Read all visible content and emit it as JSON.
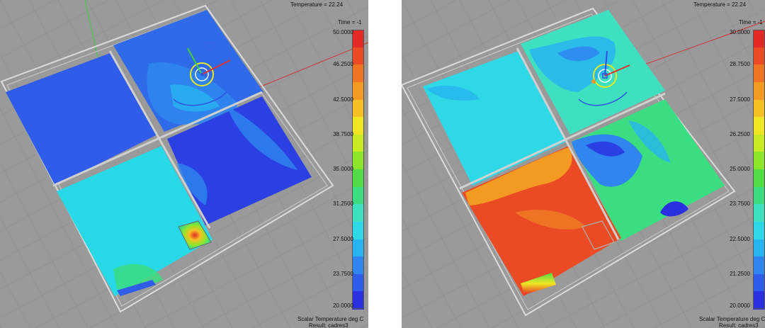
{
  "panels": [
    {
      "temperature_readout": "Temperature = 22.24",
      "time_readout": "Time = -1",
      "legend_ticks": [
        "50.0000",
        "46.2500",
        "42.5000",
        "38.7500",
        "35.0000",
        "31.2500",
        "27.5000",
        "23.7500",
        "20.0000"
      ],
      "footer_line1": "Scalar Temperature deg C",
      "footer_line2": "Result: cadres3"
    },
    {
      "temperature_readout": "Temperature = 22.24",
      "time_readout": "Time = -1",
      "legend_ticks": [
        "30.0000",
        "28.7500",
        "27.5000",
        "26.2500",
        "25.0000",
        "23.7500",
        "22.5000",
        "21.2500",
        "20.0000"
      ],
      "footer_line1": "Scalar Temperature deg C",
      "footer_line2": "Result: cadres3"
    }
  ],
  "colors": {
    "viewport_bg": "#9a9a9a",
    "grid_line": "#8a8a8a",
    "wall_line": "#d8d8d8",
    "scale": [
      "#2a2fe0",
      "#2f5ce8",
      "#2f86f0",
      "#27b4f0",
      "#2ed8e6",
      "#3ee0c0",
      "#3ade80",
      "#52dc44",
      "#8ee62c",
      "#c8ea22",
      "#f0e624",
      "#f6c024",
      "#f29a22",
      "#ee7424",
      "#ea4a24",
      "#e42a26"
    ]
  }
}
